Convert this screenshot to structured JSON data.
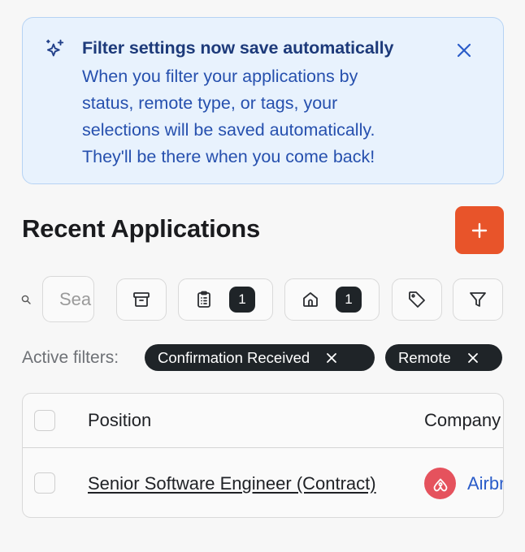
{
  "banner": {
    "title": "Filter settings now save automatically",
    "lines": [
      "When you filter your applications by",
      "status, remote type, or tags, your",
      "selections will be saved automatically.",
      "They'll be there when you come back!"
    ],
    "icon": "sparkles-icon",
    "close_icon": "close-icon"
  },
  "heading": "Recent Applications",
  "add_button": {
    "label": "+"
  },
  "search": {
    "placeholder": "Search"
  },
  "toolbar": {
    "archive_icon": "archive-icon",
    "status_filter": {
      "icon": "clipboard-list-icon",
      "count": "1"
    },
    "remote_filter": {
      "icon": "home-icon",
      "count": "1"
    },
    "tags_icon": "tag-icon",
    "filter_icon": "filter-icon"
  },
  "active_filters": {
    "label": "Active filters:",
    "chips": [
      {
        "label": "Confirmation Received"
      },
      {
        "label": "Remote"
      }
    ]
  },
  "table": {
    "columns": [
      "Position",
      "Company"
    ],
    "rows": [
      {
        "position": "Senior Software Engineer (Contract)",
        "company": "Airbnb",
        "logo": "airbnb-logo"
      }
    ]
  },
  "colors": {
    "accent": "#e8542a",
    "banner_bg": "#e8f2fd",
    "banner_text": "#2650ae",
    "chip_bg": "#1f2428",
    "link": "#2a5cc9",
    "airbnb": "#e5525d"
  }
}
